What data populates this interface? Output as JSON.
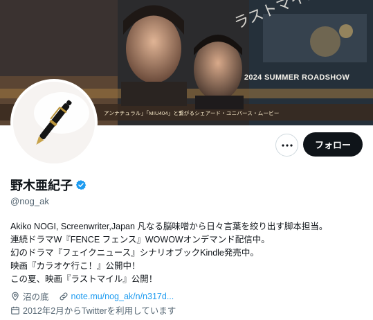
{
  "banner": {
    "title": "2024 SUMMER ROADSHOW",
    "strip_text": "アンナチュラル」「MIU404」と繋がるシェアード・ユニバース・ムービー"
  },
  "profile": {
    "display_name": "野木亜紀子",
    "handle": "@nog_ak",
    "verified_color": "#1d9bf0",
    "bio_lines": [
      "Akiko NOGI, Screenwriter,Japan 凡なる脳味噌から日々言葉を絞り出す脚本担当。",
      "連続ドラマW『FENCE フェンス』WOWOWオンデマンド配信中。",
      "幻のドラマ『フェイクニュース』シナリオブックKindle発売中。",
      "映画『カラオケ行こ！』公開中！",
      "この夏、映画『ラストマイル』公開！"
    ],
    "location": "沼の底",
    "website": "note.mu/nog_ak/n/n317d...",
    "joined": "2012年2月からTwitterを利用しています"
  },
  "actions": {
    "follow_label": "フォロー"
  },
  "icons": {
    "more": "more-horizontal-icon",
    "verified": "verified-badge-icon",
    "location": "location-pin-icon",
    "link": "link-icon",
    "calendar": "calendar-icon"
  }
}
